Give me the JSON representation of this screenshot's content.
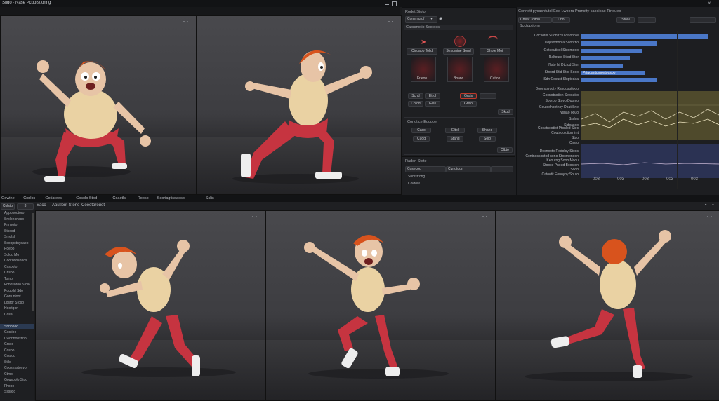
{
  "app": {
    "title": "Sfido · Nase Pcdotstlonng"
  },
  "top_viewports": [
    {
      "name": "viewport-1"
    },
    {
      "name": "viewport-2"
    }
  ],
  "inspector": {
    "title": "Rodet Stolo",
    "dropdown": "Commiuto(",
    "section": "Caonmotio Sestoes",
    "tools": [
      "Cicoaob Tolid",
      "Sesomine Sond",
      "Shote Mot"
    ],
    "previews": [
      "Frieon",
      "Boand",
      "Cation"
    ],
    "row_a": [
      "Scnd",
      "Etrol",
      "Grols"
    ],
    "row_b": [
      "Cotod",
      "Glas",
      "Grlso"
    ],
    "side_btn": "Skud",
    "group2_title": "Conotice Eocope",
    "group2_items": [
      "Caso",
      "Eltol",
      "Shand"
    ],
    "group2_tags": [
      "Cuod",
      "Stand",
      "Solo"
    ],
    "group2_btn": "Clbto",
    "sub_title": "Radon Stote",
    "sub_dropdown1": "Cosecoo",
    "sub_dropdown2": "Cunotoon",
    "sub_items": [
      "Sumstrong",
      "Coldow"
    ]
  },
  "graph": {
    "title": "Connott pysacntutol Eoe Lwoora  Pranctty caosioao Ttnoueo",
    "tabs": [
      "Cheat Tolton",
      "Cno",
      "Stool"
    ],
    "sub": "Scctdptionn",
    "bar_labels": [
      "Cocsotot Suohtt Suvssonote",
      "Dopsomnoia Suonrtlo",
      "Gotsoutiool Stuomodo",
      "Raltoure Stlod Stor",
      "Nsto lsl Dtctod Stor",
      "Stoord Stld Stor Sodo",
      "Sdn Cocust Sluptodaa"
    ],
    "bar_values": [
      0.92,
      0.55,
      0.44,
      0.35,
      0.3,
      0.46,
      0.55
    ],
    "bar_tags": [
      "",
      "",
      "",
      "",
      "",
      "Prtuoantomontousoo",
      ""
    ],
    "mid_labels": [
      "Doomssrouty Rsnuosptiooo",
      "Goonotnotion Seooatto",
      "Sooroo Stoyo Duonlo",
      "Coutoohontnoy Doat Sne",
      "Nsnao oouo",
      "Ssdos",
      "Sidoasoo"
    ],
    "lower_labels": [
      "Cooatnootiot Ptonlod Stec",
      "Coutnoolotion lmt",
      "Stso",
      "Cnsto"
    ],
    "blue_labels": [
      "Docnooto Rodoloy Stoos",
      "Contnossontod sono Stoomonodn",
      "Keoutng Sooo Moou",
      "Stooce Pnoud Booston",
      "Sooh"
    ],
    "foot_label": "Catootit Eonoypy Souto",
    "x_ticks": [
      "003",
      "003",
      "003",
      "003",
      "003"
    ],
    "accent": "#4a77c7"
  },
  "bottom": {
    "menus": [
      "Gowine",
      "Conlos",
      "Gotiatees",
      "Cosolo Stod",
      "Coaotls",
      "Rooso",
      "Ssoriagtisoaeso",
      "Sslts"
    ],
    "toolbar_left": "Colsto",
    "toolbar_sel": "3",
    "viewport_tabs": [
      "Saco",
      "Aautlont Stono",
      "Cooetorouot"
    ],
    "outliner": [
      "Apposoutoro",
      "Srolohonaso",
      "Pnnsoto",
      "Stsosd",
      "Smolsl",
      "Ssoopstnyaaoo",
      "Poeoo",
      "Soloo Mo",
      "Coordonsonos",
      "Cnsoolo",
      "Cnsoo",
      "Tolno",
      "Fonosoroo Stolo",
      "Pouoild Sdo",
      "Gorrunioot",
      "Lostor Stoso",
      "Hooltgon",
      "Cosa",
      "",
      "Shnonoo",
      "Gostioo",
      "Cwonnonstlno",
      "Grsco",
      "Cosoo",
      "Crssoo",
      "Stilo",
      "Coosnsstonyo",
      "Ctmo",
      "Gousoolo Stoo",
      "Fhooo",
      "Ssslloo"
    ],
    "outliner_sel": 19
  }
}
